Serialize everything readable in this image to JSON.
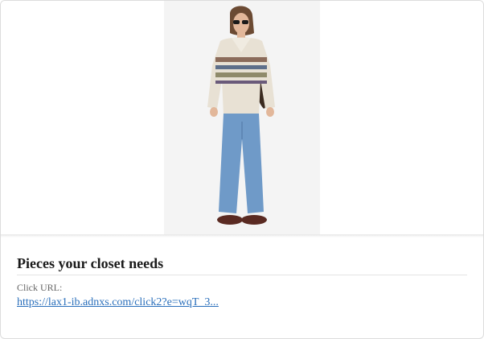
{
  "card": {
    "title": "Pieces your closet needs",
    "click_label": "Click URL:",
    "click_url": "https://lax1-ib.adnxs.com/click2?e=wqT_3..."
  },
  "image": {
    "subject": "product-photo",
    "colors": {
      "sweater": "#e8e1d4",
      "jeans": "#6f9ac8",
      "bag": "#3a2a1f",
      "shoes": "#5a2a22",
      "background": "#f4f4f4",
      "link": "#2a6fbb"
    }
  }
}
